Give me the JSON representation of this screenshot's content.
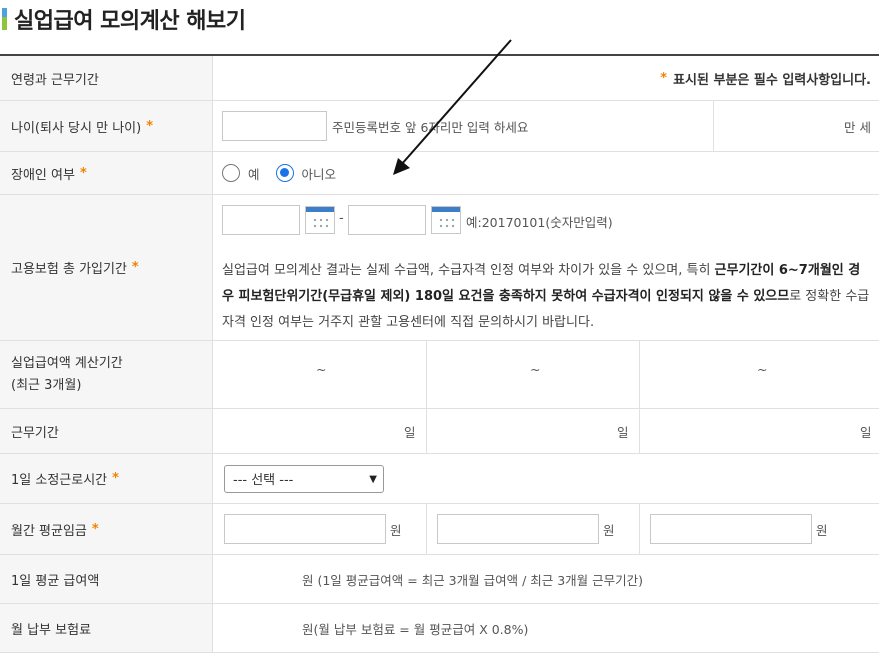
{
  "page": {
    "title": "실업급여 모의계산 해보기"
  },
  "rows": {
    "period_header": {
      "label": "연령과 근무기간",
      "required_note_star": "*",
      "required_note": "표시된 부분은 필수 입력사항입니다."
    },
    "age": {
      "label": "나이(퇴사 당시 만 나이)",
      "star": "*",
      "input_value": "",
      "hint": "주민등록번호 앞 6자리만 입력 하세요",
      "result_unit": "만 세"
    },
    "disability": {
      "label": "장애인 여부",
      "star": "*",
      "option_yes": "예",
      "option_no": "아니오",
      "selected": "아니오"
    },
    "insurance": {
      "label": "고용보험 총 가입기간",
      "star": "*",
      "start_value": "",
      "end_value": "",
      "separator": "-",
      "example": "예:20170101(숫자만입력)",
      "notice_part1": "실업급여 모의계산 결과는 실제 수급액, 수급자격 인정 여부와 차이가 있을 수 있으며, 특히 ",
      "notice_bold": "근무기간이 6~7개월인 경우 피보험단위기간(무급휴일 제외) 180일 요건을 충족하지 못하여 수급자격이 인정되지 않을 수 있으므",
      "notice_part2": "로 정확한 수급자격 인정 여부는 거주지 관할 고용센터에 직접 문의하시기 바랍니다."
    },
    "calc_period": {
      "label_line1": "실업급여액 계산기간",
      "label_line2": "(최근 3개월)",
      "tilde": "~"
    },
    "work_period": {
      "label": "근무기간",
      "unit": "일"
    },
    "daily_hours": {
      "label": "1일 소정근로시간",
      "star": "*",
      "selected": "--- 선택 ---"
    },
    "monthly_wage": {
      "label": "월간 평균임금",
      "star": "*",
      "unit": "원"
    },
    "daily_benefit": {
      "label": "1일 평균 급여액",
      "text": "원 (1일 평균급여액 = 최근 3개월 급여액 / 최근 3개월 근무기간)"
    },
    "monthly_premium": {
      "label": "월 납부 보험료",
      "text": "원(월 납부 보험료 = 월 평균급여 X 0.8%)"
    }
  },
  "colors": {
    "accent_star": "#f08300",
    "radio_selected": "#1a73e8",
    "calendar_header": "#3d7ec8",
    "title_mark_top": "#4aa3df",
    "title_mark_bottom": "#8cc63f"
  }
}
